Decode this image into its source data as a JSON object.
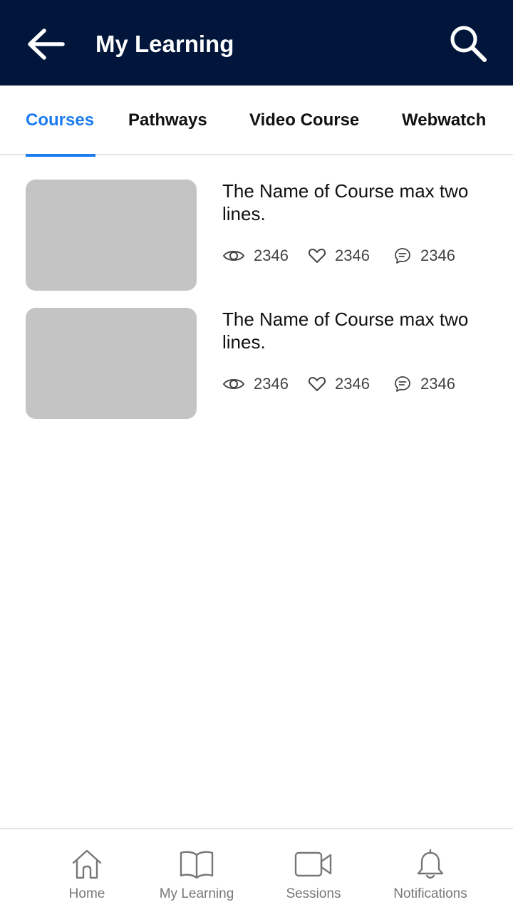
{
  "header": {
    "title": "My Learning",
    "back_icon": "arrow-left-icon",
    "search_icon": "search-icon",
    "background": "#01163a"
  },
  "tabs": [
    {
      "label": "Courses",
      "active": true
    },
    {
      "label": "Pathways",
      "active": false
    },
    {
      "label": "Video Course",
      "active": false
    },
    {
      "label": "Webwatch",
      "active": false
    }
  ],
  "accent_color": "#1a7cf0",
  "courses": [
    {
      "title": "The Name of Course max two lines.",
      "views": "2346",
      "likes": "2346",
      "comments": "2346"
    },
    {
      "title": "The Name of Course max two lines.",
      "views": "2346",
      "likes": "2346",
      "comments": "2346"
    }
  ],
  "bottom_nav": [
    {
      "label": "Home",
      "icon": "home-icon"
    },
    {
      "label": "My Learning",
      "icon": "book-icon"
    },
    {
      "label": "Sessions",
      "icon": "video-camera-icon"
    },
    {
      "label": "Notifications",
      "icon": "bell-icon"
    }
  ]
}
